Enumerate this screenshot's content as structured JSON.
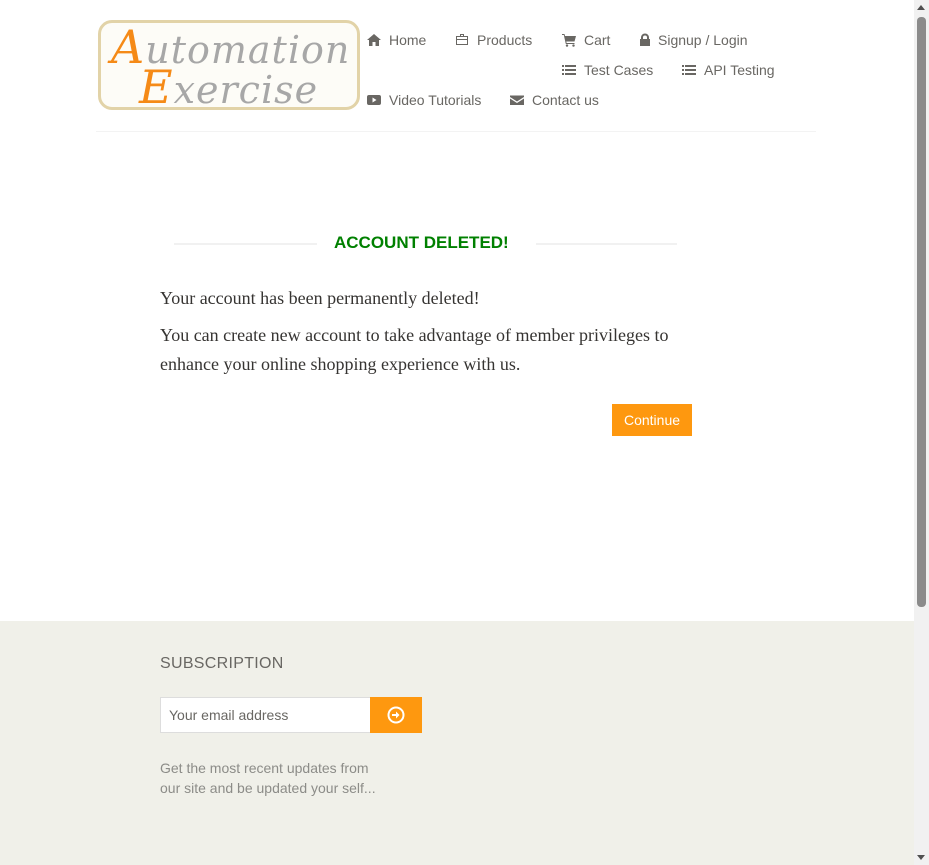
{
  "logo": {
    "line1_cap": "A",
    "line1_rest": "utomation",
    "line2_cap": "E",
    "line2_rest": "xercise"
  },
  "nav": {
    "home": "Home",
    "products": "Products",
    "cart": "Cart",
    "signup_login": "Signup / Login",
    "test_cases": "Test Cases",
    "api_testing": "API Testing",
    "video_tutorials": "Video Tutorials",
    "contact_us": "Contact us"
  },
  "main": {
    "title": "ACCOUNT DELETED!",
    "message1": "Your account has been permanently deleted!",
    "message2": "You can create new account to take advantage of member privileges to enhance your online shopping experience with us.",
    "continue_label": "Continue"
  },
  "footer": {
    "subscription_title": "SUBSCRIPTION",
    "email_placeholder": "Your email address",
    "note": "Get the most recent updates from our site and be updated your self..."
  },
  "colors": {
    "accent": "#fe980f",
    "success": "#008000",
    "footer_bg": "#f0f0e9"
  },
  "icons": [
    "home-icon",
    "briefcase-icon",
    "cart-icon",
    "lock-icon",
    "list-icon",
    "youtube-play-icon",
    "envelope-icon",
    "arrow-circle-right-icon"
  ]
}
